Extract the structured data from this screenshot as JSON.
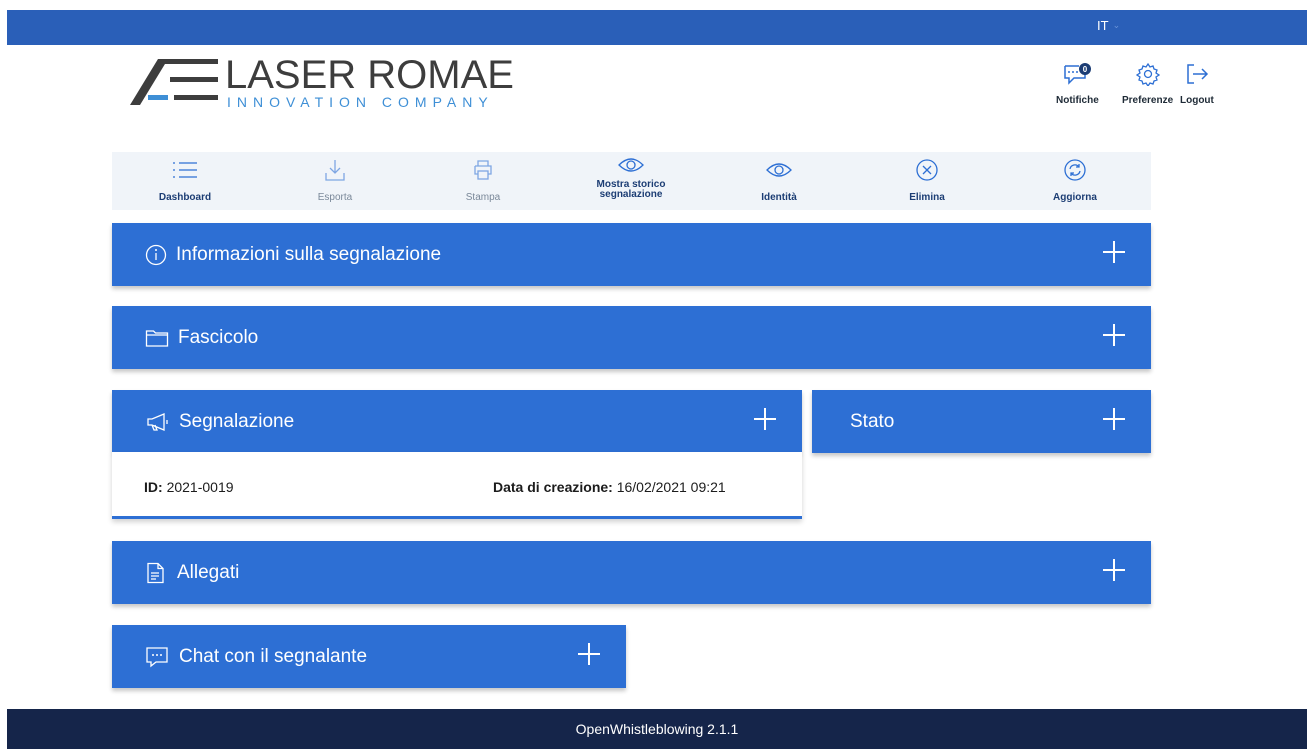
{
  "header": {
    "language": "IT",
    "logo": {
      "brand": "LASER ROMAE",
      "tagline": "INNOVATION COMPANY"
    },
    "nav": [
      {
        "label": "Notifiche",
        "icon": "notification-chat-icon",
        "badge": "0"
      },
      {
        "label": "Preferenze",
        "icon": "gear-icon"
      },
      {
        "label": "Logout",
        "icon": "logout-icon"
      }
    ]
  },
  "toolbar": {
    "items": [
      {
        "label": "Dashboard",
        "icon": "list-icon",
        "state": "active"
      },
      {
        "label": "Esporta",
        "icon": "download-icon",
        "state": "disabled"
      },
      {
        "label": "Stampa",
        "icon": "printer-icon",
        "state": "disabled"
      },
      {
        "label_line1": "Mostra storico",
        "label_line2": "segnalazione",
        "icon": "eye-icon",
        "state": "active"
      },
      {
        "label": "Identità",
        "icon": "eye-icon",
        "state": "active"
      },
      {
        "label": "Elimina",
        "icon": "close-circle-icon",
        "state": "active"
      },
      {
        "label": "Aggiorna",
        "icon": "refresh-circle-icon",
        "state": "active"
      }
    ]
  },
  "panels": {
    "info": {
      "title": "Informazioni sulla segnalazione",
      "icon": "info-icon"
    },
    "fascicolo": {
      "title": "Fascicolo",
      "icon": "folder-icon"
    },
    "segnalazione": {
      "title": "Segnalazione",
      "icon": "megaphone-icon",
      "id_label": "ID:",
      "id_value": "2021-0019",
      "date_label": "Data di creazione:",
      "date_value": "16/02/2021 09:21"
    },
    "stato": {
      "title": "Stato"
    },
    "allegati": {
      "title": "Allegati",
      "icon": "document-icon"
    },
    "chat": {
      "title": "Chat con il segnalante",
      "icon": "chat-icon"
    }
  },
  "footer": {
    "text": "OpenWhistleblowing 2.1.1"
  },
  "colors": {
    "topbar": "#2a5fb8",
    "panel": "#2d6fd4",
    "footer": "#15254a",
    "accent": "#3e8fd6"
  }
}
